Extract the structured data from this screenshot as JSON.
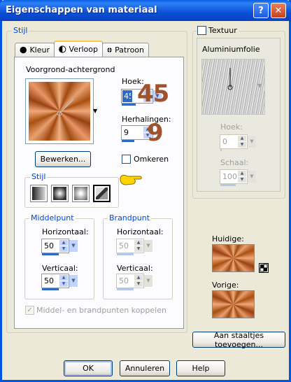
{
  "window": {
    "title": "Eigenschappen van materiaal",
    "help_glyph": "?",
    "close_glyph": "✕"
  },
  "stijl_group": {
    "label": "Stijl",
    "tabs": [
      {
        "label": "Kleur",
        "icon": "filled-circle-icon"
      },
      {
        "label": "Verloop",
        "icon": "half-circle-icon"
      },
      {
        "label": "Patroon",
        "icon": "pattern-icon"
      }
    ],
    "active_tab": "Verloop"
  },
  "gradient_panel": {
    "gradient_name": "Voorgrond-achtergrond",
    "edit_button": "Bewerken...",
    "hoek_label": "Hoek:",
    "hoek_value": "45",
    "herhalingen_label": "Herhalingen:",
    "herhalingen_value": "9",
    "omkeren_label": "Omkeren",
    "omkeren_checked": false,
    "stijl_label": "Stijl",
    "overlay_angle": "45",
    "overlay_repeats": "9",
    "colors": {
      "orange": "#c86a2e",
      "overlay_brown": "#a0522d",
      "selection_blue": "#316ac5"
    }
  },
  "middelpunt": {
    "label": "Middelpunt",
    "horizontaal_label": "Horizontaal:",
    "horizontaal_value": "50",
    "verticaal_label": "Verticaal:",
    "verticaal_value": "50"
  },
  "brandpunt": {
    "label": "Brandpunt",
    "horizontaal_label": "Horizontaal:",
    "horizontaal_value": "50",
    "verticaal_label": "Verticaal:",
    "verticaal_value": "50"
  },
  "koppelen_label": "Middel- en brandpunten koppelen",
  "koppelen_checked": true,
  "textuur": {
    "label": "Textuur",
    "checked": false,
    "texture_name": "Aluminiumfolie",
    "hoek_label": "Hoek:",
    "hoek_value": "0",
    "schaal_label": "Schaal:",
    "schaal_value": "100"
  },
  "preview": {
    "huidige_label": "Huidige:",
    "vorige_label": "Vorige:"
  },
  "add_swatch_button": "Aan staaltjes toevoegen...",
  "buttons": {
    "ok": "OK",
    "cancel": "Annuleren",
    "help": "Help"
  }
}
